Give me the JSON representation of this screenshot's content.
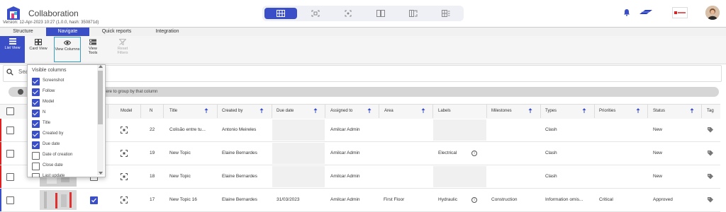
{
  "header": {
    "title": "Collaboration",
    "version": "Version: 12-Apr-2023 10:27 (1.0.0, hash: 350871d)"
  },
  "view_switch": [
    "grid-view",
    "fit-view",
    "focus-view",
    "split-view",
    "compare-view",
    "list-grid-view"
  ],
  "tabs": [
    "Structure",
    "Navigate",
    "Quick reports",
    "Integration"
  ],
  "active_tab": "Navigate",
  "ribbon": {
    "list_view": "List View",
    "card_view": "Card View",
    "view_columns": "View Columns",
    "view_tools": "View Tools",
    "reset_filters": "Reset Filters"
  },
  "search": {
    "placeholder": "Sea"
  },
  "group_hint": "here to group by that column",
  "columns": {
    "model": "Model",
    "n": "N",
    "title": "Title",
    "created_by": "Created by",
    "due_date": "Due date",
    "assigned_to": "Assigned to",
    "area": "Area",
    "labels": "Labels",
    "milestones": "Milestones",
    "types": "Types",
    "priorities": "Priorities",
    "status": "Status",
    "tag": "Tag"
  },
  "rows": [
    {
      "n": "22",
      "title": "Colisão entre tu...",
      "created_by": "Antonio Meireles",
      "due_date": "",
      "assigned_to": "Amilcar Admin",
      "area": "",
      "labels": "",
      "milestones": "",
      "types": "Clash",
      "priorities": "",
      "status": "New",
      "flag_color": "#e02020"
    },
    {
      "n": "19",
      "title": "New Topic",
      "created_by": "Elaine Bernardes",
      "due_date": "",
      "assigned_to": "Amilcar Admin",
      "area": "",
      "labels": "Electrical",
      "milestones": "",
      "types": "Clash",
      "priorities": "",
      "status": "New",
      "flag_color": "#e02020"
    },
    {
      "n": "18",
      "title": "New Topic",
      "created_by": "Elaine Bernardes",
      "due_date": "",
      "assigned_to": "Amilcar Admin",
      "area": "",
      "labels": "",
      "milestones": "",
      "types": "Clash",
      "priorities": "",
      "status": "New",
      "flag_color": "#e02020"
    },
    {
      "n": "17",
      "title": "New Topic 16",
      "created_by": "Elaine Bernardes",
      "due_date": "31/03/2023",
      "assigned_to": "Amilcar Admin",
      "area": "First Floor",
      "labels": "Hydraulic",
      "milestones": "Construction",
      "types": "Information omis...",
      "priorities": "Critical",
      "status": "Approved",
      "flag_color": "#3a4fc7"
    }
  ],
  "column_menu": {
    "title": "Visible columns",
    "items": [
      {
        "label": "Screenshot",
        "checked": true
      },
      {
        "label": "Follow",
        "checked": true
      },
      {
        "label": "Model",
        "checked": true
      },
      {
        "label": "N",
        "checked": true
      },
      {
        "label": "Title",
        "checked": true
      },
      {
        "label": "Created by",
        "checked": true
      },
      {
        "label": "Due date",
        "checked": true
      },
      {
        "label": "Date of creation",
        "checked": false
      },
      {
        "label": "Close date",
        "checked": false
      },
      {
        "label": "Last update",
        "checked": false
      }
    ]
  },
  "colors": {
    "accent": "#3a4fc7",
    "flag_red": "#e02020"
  }
}
